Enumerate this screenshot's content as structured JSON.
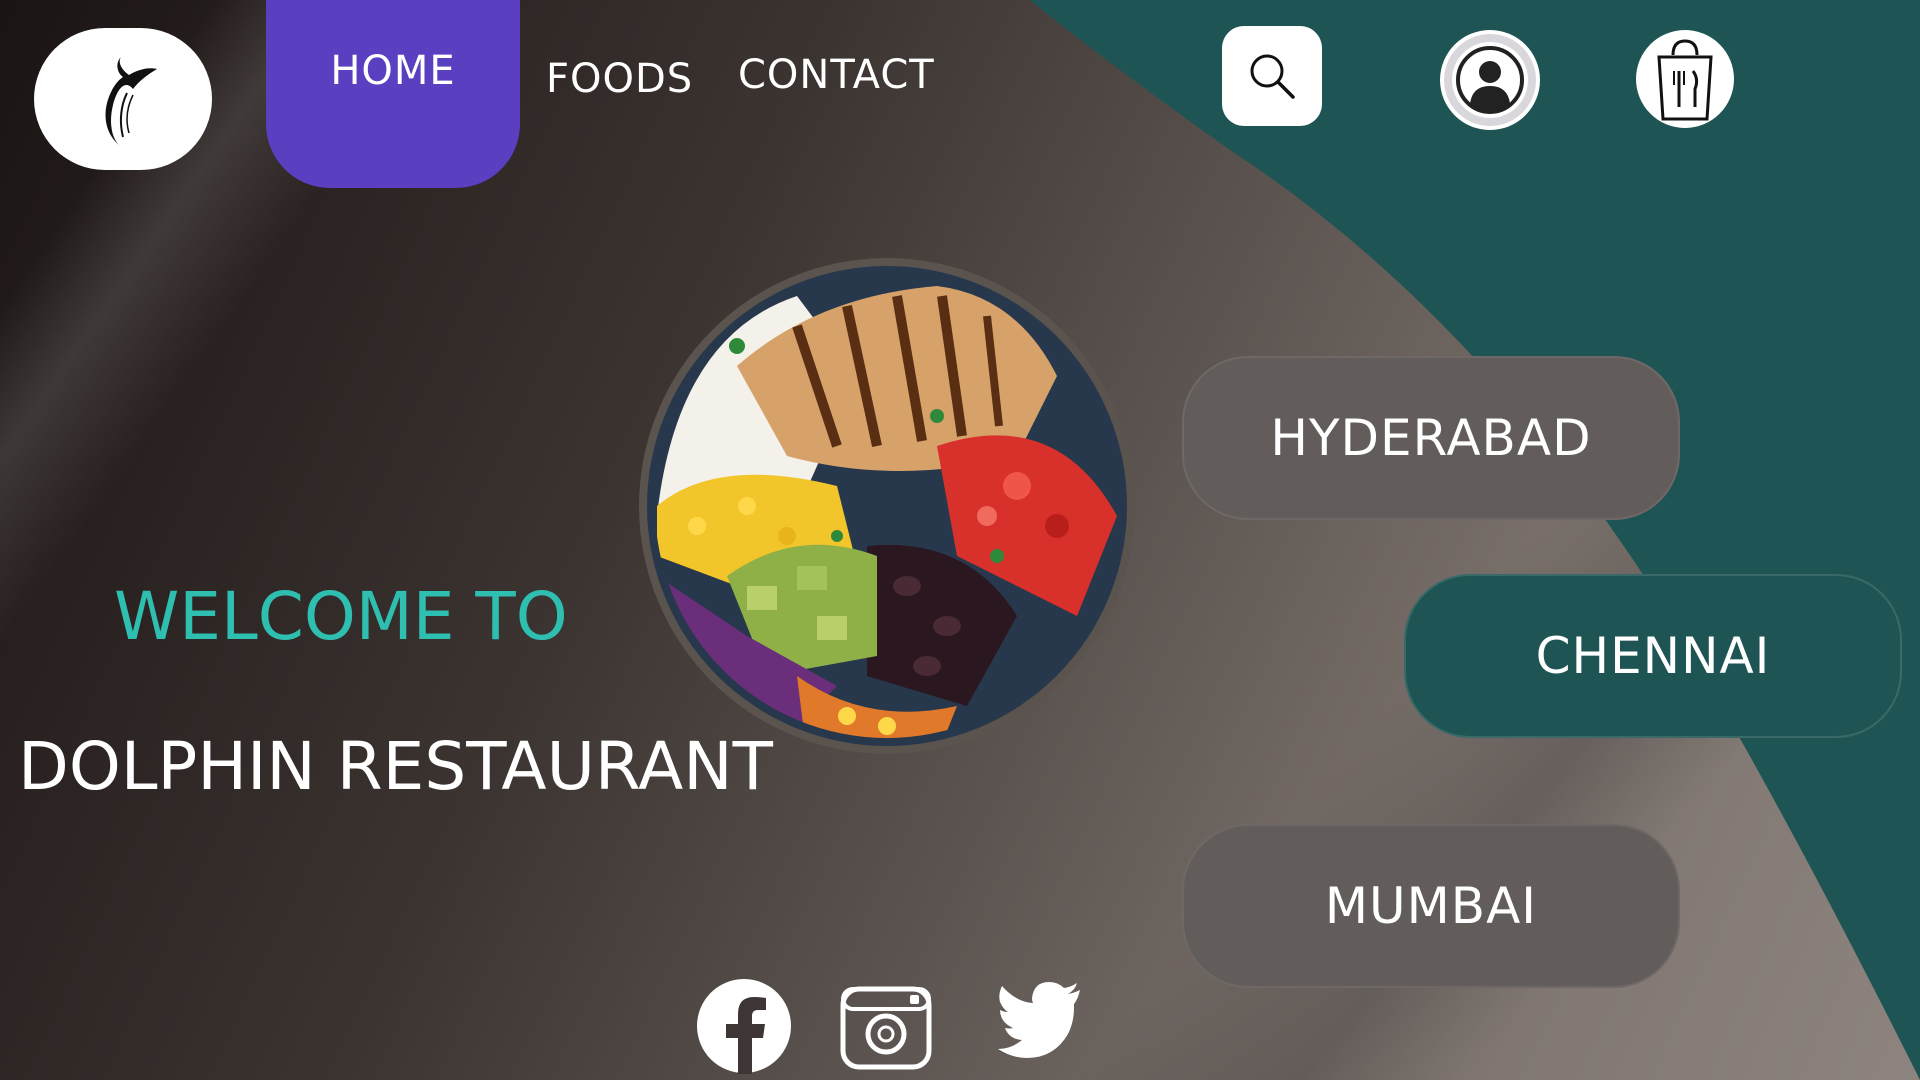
{
  "nav": {
    "logo_icon": "dolphin-tail-logo",
    "home_label": "HOME",
    "foods_label": "FOODS",
    "contact_label": "CONTACT"
  },
  "header_icons": {
    "search": "search-icon",
    "user": "user-icon",
    "bag": "shopping-bag-icon"
  },
  "hero": {
    "welcome_text": "WELCOME TO",
    "restaurant_name": "DOLPHIN RESTAURANT",
    "image": "food-bowl-image"
  },
  "cities": [
    {
      "label": "HYDERABAD"
    },
    {
      "label": "CHENNAI"
    },
    {
      "label": "MUMBAI"
    }
  ],
  "social": [
    "facebook-icon",
    "instagram-icon",
    "twitter-icon"
  ],
  "colors": {
    "accent_purple": "#5a3fc0",
    "teal": "#1e5554",
    "welcome_teal": "#2fbfb0",
    "city_grey": "#625c5b"
  }
}
